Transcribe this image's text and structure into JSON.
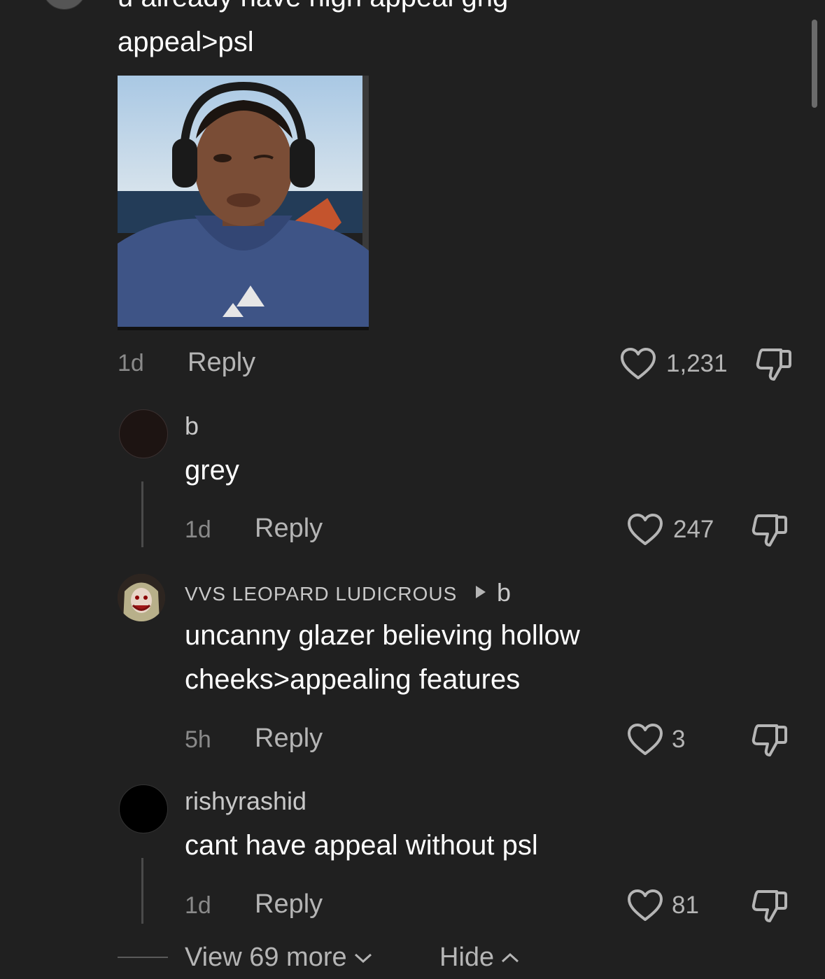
{
  "parent": {
    "text_cut": "u already have high appeal gng",
    "text": "appeal>psl",
    "time": "1d",
    "reply_label": "Reply",
    "likes": "1,231"
  },
  "replies": [
    {
      "username": "b",
      "text_lines": [
        "grey"
      ],
      "time": "1d",
      "reply_label": "Reply",
      "likes": "247"
    },
    {
      "username": "VVS LEOPARD LUDICROUS",
      "reply_to": "b",
      "text_lines": [
        "uncanny glazer believing hollow",
        "cheeks>appealing features"
      ],
      "time": "5h",
      "reply_label": "Reply",
      "likes": "3"
    },
    {
      "username": "rishyrashid",
      "text_lines": [
        "cant have appeal without psl"
      ],
      "time": "1d",
      "reply_label": "Reply",
      "likes": "81"
    }
  ],
  "footer": {
    "view_more": "View 69 more",
    "hide": "Hide"
  },
  "icons": {
    "like": "heart-outline-icon",
    "dislike": "thumbs-down-outline-icon",
    "reply_arrow": "triangle-right-icon",
    "chevron_down": "chevron-down-icon",
    "chevron_up": "chevron-up-icon"
  },
  "colors": {
    "background": "#202020",
    "text": "#ffffff",
    "muted": "#b5b5b5",
    "time": "#8a8a8a"
  }
}
